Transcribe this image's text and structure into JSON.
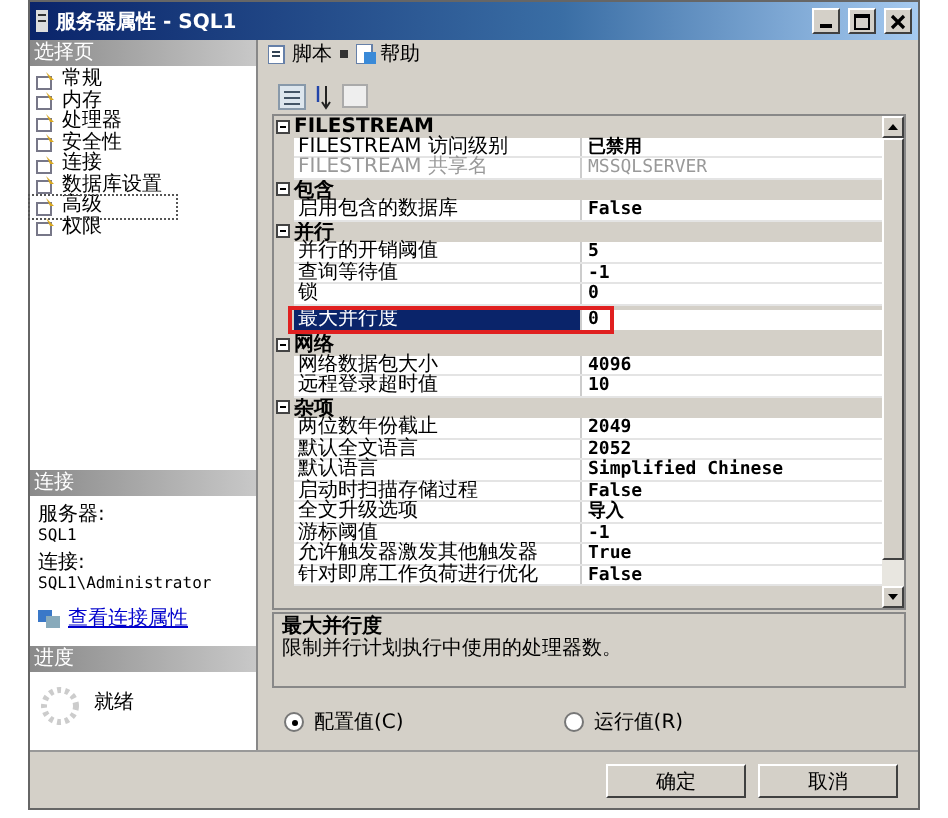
{
  "window": {
    "title": "服务器属性 - SQL1"
  },
  "sidebar": {
    "header": "选择页",
    "items": [
      {
        "label": "常规",
        "selected": false
      },
      {
        "label": "内存",
        "selected": false
      },
      {
        "label": "处理器",
        "selected": false
      },
      {
        "label": "安全性",
        "selected": false
      },
      {
        "label": "连接",
        "selected": false
      },
      {
        "label": "数据库设置",
        "selected": false
      },
      {
        "label": "高级",
        "selected": true
      },
      {
        "label": "权限",
        "selected": false
      }
    ]
  },
  "connection": {
    "header": "连接",
    "server_label": "服务器:",
    "server": "SQL1",
    "connection_label": "连接:",
    "connection": "SQL1\\Administrator",
    "link": "查看连接属性"
  },
  "progress": {
    "header": "进度",
    "status": "就绪"
  },
  "toolbar": {
    "script": "脚本",
    "help": "帮助"
  },
  "grid": {
    "categories": [
      {
        "name": "FILESTREAM",
        "expanded": true,
        "properties": [
          {
            "name": "FILESTREAM 访问级别",
            "value": "已禁用",
            "disabled": false,
            "selected": false,
            "highlighted": false
          },
          {
            "name": "FILESTREAM 共享名",
            "value": "MSSQLSERVER",
            "disabled": true,
            "selected": false,
            "highlighted": false
          }
        ]
      },
      {
        "name": "包含",
        "expanded": true,
        "properties": [
          {
            "name": "启用包含的数据库",
            "value": "False",
            "disabled": false,
            "selected": false,
            "highlighted": false
          }
        ]
      },
      {
        "name": "并行",
        "expanded": true,
        "properties": [
          {
            "name": "并行的开销阈值",
            "value": "5",
            "disabled": false,
            "selected": false,
            "highlighted": false
          },
          {
            "name": "查询等待值",
            "value": "-1",
            "disabled": false,
            "selected": false,
            "highlighted": false
          },
          {
            "name": "锁",
            "value": "0",
            "disabled": false,
            "selected": false,
            "highlighted": false
          },
          {
            "name": "最大并行度",
            "value": "0",
            "disabled": false,
            "selected": true,
            "highlighted": true
          }
        ]
      },
      {
        "name": "网络",
        "expanded": true,
        "properties": [
          {
            "name": "网络数据包大小",
            "value": "4096",
            "disabled": false,
            "selected": false,
            "highlighted": false
          },
          {
            "name": "远程登录超时值",
            "value": "10",
            "disabled": false,
            "selected": false,
            "highlighted": false
          }
        ]
      },
      {
        "name": "杂项",
        "expanded": true,
        "properties": [
          {
            "name": "两位数年份截止",
            "value": "2049",
            "disabled": false,
            "selected": false,
            "highlighted": false
          },
          {
            "name": "默认全文语言",
            "value": "2052",
            "disabled": false,
            "selected": false,
            "highlighted": false
          },
          {
            "name": "默认语言",
            "value": "Simplified Chinese",
            "disabled": false,
            "selected": false,
            "highlighted": false
          },
          {
            "name": "启动时扫描存储过程",
            "value": "False",
            "disabled": false,
            "selected": false,
            "highlighted": false
          },
          {
            "name": "全文升级选项",
            "value": "导入",
            "disabled": false,
            "selected": false,
            "highlighted": false
          },
          {
            "name": "游标阈值",
            "value": "-1",
            "disabled": false,
            "selected": false,
            "highlighted": false
          },
          {
            "name": "允许触发器激发其他触发器",
            "value": "True",
            "disabled": false,
            "selected": false,
            "highlighted": false
          },
          {
            "name": "针对即席工作负荷进行优化",
            "value": "False",
            "disabled": false,
            "selected": false,
            "highlighted": false
          }
        ]
      }
    ]
  },
  "description": {
    "title": "最大并行度",
    "text": "限制并行计划执行中使用的处理器数。"
  },
  "radios": [
    {
      "label": "配置值(C)",
      "selected": true
    },
    {
      "label": "运行值(R)",
      "selected": false
    }
  ],
  "buttons": [
    "确定",
    "取消"
  ]
}
